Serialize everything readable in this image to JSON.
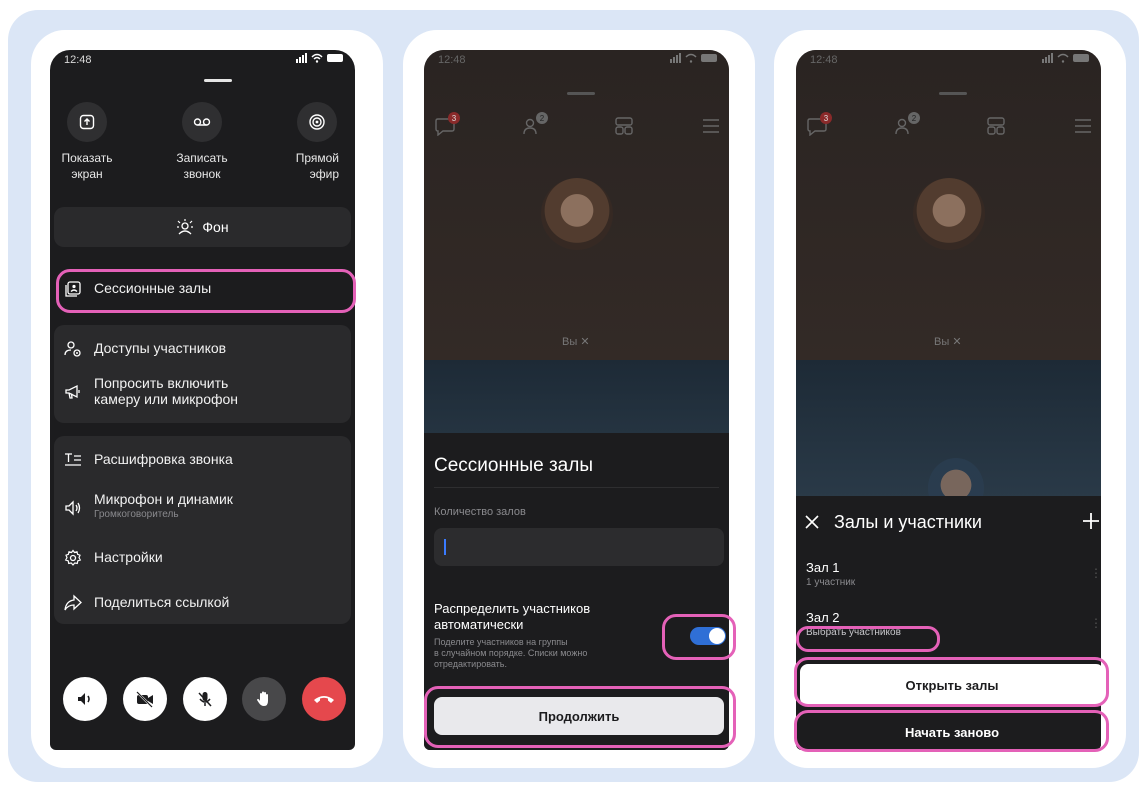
{
  "phone1": {
    "status_time": "12:48",
    "top_actions": [
      {
        "icon": "upload-screen-icon",
        "label_line1": "Показать",
        "label_line2": "экран"
      },
      {
        "icon": "voicemail-record-icon",
        "label_line1": "Записать",
        "label_line2": "звонок"
      },
      {
        "icon": "live-broadcast-icon",
        "label_line1": "Прямой",
        "label_line2": "эфир"
      }
    ],
    "background_button": "Фон",
    "session_rooms": "Сессионные залы",
    "participant_access": "Доступы участников",
    "ask_enable_line1": "Попросить включить",
    "ask_enable_line2": "камеру или микрофон",
    "transcript": "Расшифровка звонка",
    "mic_speaker": "Микрофон и динамик",
    "mic_speaker_sub": "Громкоговоритель",
    "settings": "Настройки",
    "share_link": "Поделиться ссылкой"
  },
  "phone2": {
    "status_time": "12:48",
    "chat_badge": "3",
    "people_badge": "2",
    "self_label": "Вы",
    "sheet_title": "Сессионные залы",
    "rooms_count_label": "Количество залов",
    "distribute_line1": "Распределить участников",
    "distribute_line2": "автоматически",
    "distribute_hint_line1": "Поделите участников на группы",
    "distribute_hint_line2": "в случайном порядке. Списки можно",
    "distribute_hint_line3": "отредактировать.",
    "continue_button": "Продолжить"
  },
  "phone3": {
    "status_time": "12:48",
    "chat_badge": "3",
    "people_badge": "2",
    "self_label": "Вы",
    "sheet_title": "Залы и участники",
    "room1_name": "Зал 1",
    "room1_sub": "1 участник",
    "room2_name": "Зал 2",
    "room2_sub": "Выбрать участников",
    "open_rooms_button": "Открыть залы",
    "restart_button": "Начать заново"
  },
  "colors": {
    "highlight": "#e461b8",
    "toggle": "#2f6fd6",
    "end_call": "#e5484d",
    "badge": "#e5484d"
  }
}
